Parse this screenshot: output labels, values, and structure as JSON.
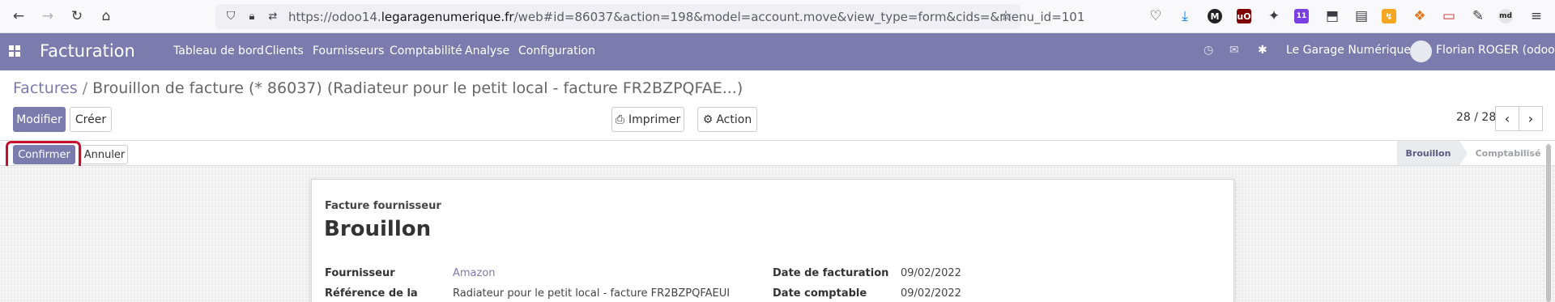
{
  "browser": {
    "url_prefix": "https://odoo14.",
    "url_host": "legaragenumerique.fr",
    "url_suffix": "/web#id=86037&action=198&model=account.move&view_type=form&cids=&menu_id=101",
    "badge_count": "11",
    "ext_labels": [
      "M",
      "uO",
      "md"
    ]
  },
  "navbar": {
    "brand": "Facturation",
    "menu": [
      "Tableau de bord",
      "Clients",
      "Fournisseurs",
      "Comptabilité",
      "Analyse",
      "Configuration"
    ],
    "company": "Le Garage Numérique",
    "user": "Florian ROGER (odoo)"
  },
  "breadcrumb": {
    "parent": "Factures",
    "separator": "/",
    "current": "Brouillon de facture (* 86037) (Radiateur pour le petit local - facture FR2BZPQFAE...)"
  },
  "control": {
    "edit": "Modifier",
    "create": "Créer",
    "print": "Imprimer",
    "action": "Action",
    "pager": "28 / 28"
  },
  "statusbar": {
    "confirm": "Confirmer",
    "cancel": "Annuler",
    "stages": [
      "Brouillon",
      "Comptabilisé"
    ]
  },
  "form": {
    "doc_type": "Facture fournisseur",
    "title": "Brouillon",
    "vendor_label": "Fournisseur",
    "vendor": "Amazon",
    "ref_label": "Référence de la",
    "ref": "Radiateur pour le petit local - facture FR2BZPQFAEUI",
    "invoice_date_label": "Date de facturation",
    "invoice_date": "09/02/2022",
    "accounting_date_label": "Date comptable",
    "accounting_date": "09/02/2022"
  },
  "colors": {
    "brand": "#7c7bad",
    "highlight": "#c8102e"
  }
}
